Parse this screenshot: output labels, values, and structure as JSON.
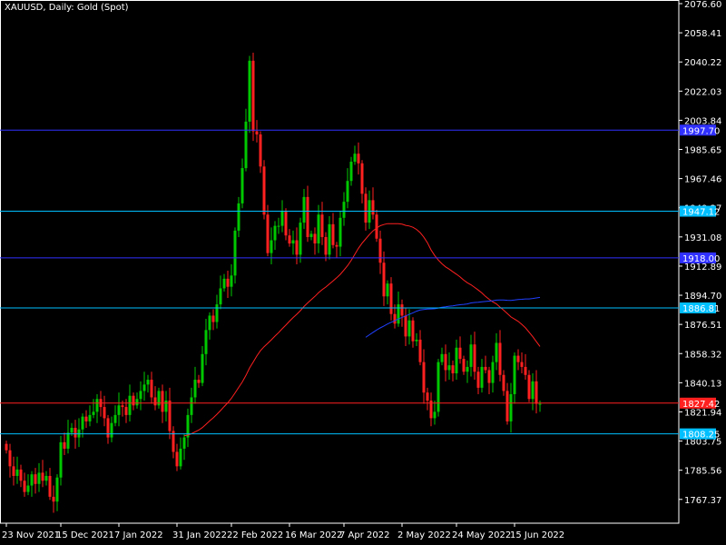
{
  "header": {
    "title": "XAUUSD, Daily:  Gold (Spot)"
  },
  "colors": {
    "background": "#000000",
    "axis": "#ffffff",
    "candle_up": "#00c800",
    "candle_down": "#ff2020",
    "ma_fast": "#ff2020",
    "ma_slow": "#2040ff"
  },
  "chart_data": {
    "type": "candlestick",
    "symbol": "XAUUSD",
    "timeframe": "Daily",
    "ylim": [
      1752.51,
      2076.6
    ],
    "y_ticks": [
      "2076.60",
      "2058.41",
      "2040.22",
      "2022.03",
      "2003.84",
      "1985.65",
      "1967.46",
      "1949.27",
      "1931.08",
      "1912.89",
      "1894.70",
      "1876.51",
      "1858.32",
      "1840.13",
      "1821.94",
      "1803.75",
      "1785.56",
      "1767.37"
    ],
    "x_ticks": [
      "23 Nov 2021",
      "15 Dec 2021",
      "7 Jan 2022",
      "31 Jan 2022",
      "22 Feb 2022",
      "16 Mar 2022",
      "7 Apr 2022",
      "2 May 2022",
      "24 May 2022",
      "15 Jun 2022"
    ],
    "x_tick_index": [
      0,
      15,
      31,
      47,
      62,
      78,
      93,
      109,
      124,
      140
    ],
    "horizontal_levels": [
      {
        "value": "1997.70",
        "color": "#3030ff",
        "label_bg": "#3030ff"
      },
      {
        "value": "1947.12",
        "color": "#00bfff",
        "label_bg": "#00bfff"
      },
      {
        "value": "1918.00",
        "color": "#3030ff",
        "label_bg": "#3030ff"
      },
      {
        "value": "1886.81",
        "color": "#00bfff",
        "label_bg": "#00bfff"
      },
      {
        "value": "1827.42",
        "color": "#ff2020",
        "label_bg": "#ff2020"
      },
      {
        "value": "1808.25",
        "color": "#00bfff",
        "label_bg": "#00bfff"
      }
    ],
    "closes": [
      1798,
      1788,
      1782,
      1786,
      1779,
      1772,
      1776,
      1783,
      1777,
      1784,
      1779,
      1782,
      1769,
      1766,
      1781,
      1803,
      1799,
      1809,
      1812,
      1806,
      1811,
      1819,
      1816,
      1820,
      1822,
      1830,
      1825,
      1818,
      1806,
      1815,
      1820,
      1826,
      1825,
      1820,
      1832,
      1826,
      1830,
      1835,
      1839,
      1842,
      1831,
      1826,
      1835,
      1822,
      1829,
      1810,
      1797,
      1788,
      1799,
      1806,
      1820,
      1831,
      1842,
      1840,
      1858,
      1873,
      1882,
      1878,
      1889,
      1899,
      1905,
      1900,
      1907,
      1935,
      1952,
      1974,
      2003,
      2041,
      1997,
      1995,
      1975,
      1945,
      1921,
      1929,
      1938,
      1938,
      1947,
      1932,
      1927,
      1929,
      1920,
      1940,
      1956,
      1931,
      1933,
      1927,
      1945,
      1931,
      1920,
      1939,
      1926,
      1925,
      1943,
      1953,
      1966,
      1978,
      1983,
      1977,
      1958,
      1940,
      1954,
      1945,
      1930,
      1915,
      1894,
      1902,
      1883,
      1877,
      1889,
      1882,
      1869,
      1879,
      1866,
      1867,
      1853,
      1834,
      1829,
      1818,
      1822,
      1853,
      1858,
      1848,
      1851,
      1846,
      1862,
      1855,
      1847,
      1850,
      1864,
      1847,
      1837,
      1850,
      1848,
      1840,
      1853,
      1865,
      1845,
      1835,
      1816,
      1833,
      1857,
      1853,
      1850,
      1845,
      1830,
      1841,
      1827,
      1827
    ]
  }
}
